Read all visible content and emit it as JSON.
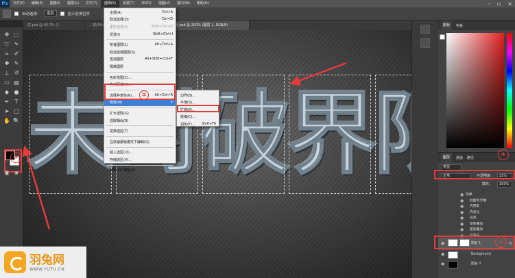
{
  "app": {
    "logo": "Ps"
  },
  "menubar": {
    "items": [
      "文件(F)",
      "编辑(E)",
      "图像(I)",
      "图层(L)",
      "文字(Y)",
      "选择(S)",
      "滤镜(T)",
      "3D(D)",
      "视图(V)",
      "窗口(W)",
      "帮助(H)"
    ],
    "active_index": 5
  },
  "options": {
    "auto_select_label": "自动选择：",
    "auto_select_value": "图层",
    "transform_label": "显示变换控件"
  },
  "tabs": [
    {
      "label": "优.psd @ 66.7% (1",
      "active": false
    },
    {
      "label": "…按(Alt+ctrl+…全图…",
      "active": false
    },
    {
      "label": "图文神经.psd @ 200% (图层 1, RGB/8)",
      "active": true
    }
  ],
  "select_menu": {
    "items": [
      {
        "label": "全部(A)",
        "shortcut": "Ctrl+A",
        "disabled": false
      },
      {
        "label": "取消选择(D)",
        "shortcut": "Ctrl+D",
        "disabled": false
      },
      {
        "label": "重新选择(E)",
        "shortcut": "Shift+Ctrl+D",
        "disabled": true
      },
      {
        "label": "反选(I)",
        "shortcut": "Shift+Ctrl+I",
        "disabled": false
      },
      {
        "sep": true
      },
      {
        "label": "所有图层(L)",
        "shortcut": "Alt+Ctrl+A",
        "disabled": false
      },
      {
        "label": "取消选择图层(S)",
        "shortcut": "",
        "disabled": false
      },
      {
        "label": "查找图层",
        "shortcut": "Alt+Shift+Ctrl+F",
        "disabled": false
      },
      {
        "label": "隔离图层",
        "shortcut": "",
        "disabled": false
      },
      {
        "sep": true
      },
      {
        "label": "色彩范围(C)...",
        "shortcut": "",
        "disabled": false
      },
      {
        "label": "焦点区域(U)...",
        "shortcut": "",
        "disabled": false
      },
      {
        "sep": true
      },
      {
        "label": "选择并遮住(K)...",
        "shortcut": "Alt+Ctrl+R",
        "disabled": false
      },
      {
        "label": "修改(M)",
        "shortcut": "▸",
        "disabled": false,
        "highlight": true
      },
      {
        "sep": true
      },
      {
        "label": "扩大选取(G)",
        "shortcut": "",
        "disabled": false
      },
      {
        "label": "选取相似(R)",
        "shortcut": "",
        "disabled": false
      },
      {
        "sep": true
      },
      {
        "label": "变换选区(T)",
        "shortcut": "",
        "disabled": false
      },
      {
        "sep": true
      },
      {
        "label": "在快速蒙版模式下编辑(Q)",
        "shortcut": "",
        "disabled": false
      },
      {
        "sep": true
      },
      {
        "label": "载入选区(O)...",
        "shortcut": "",
        "disabled": false
      },
      {
        "label": "存储选区(V)...",
        "shortcut": "",
        "disabled": false
      },
      {
        "sep": true
      },
      {
        "label": "新建 3D 模型(3)",
        "shortcut": "",
        "disabled": false
      }
    ]
  },
  "modify_submenu": {
    "items": [
      {
        "label": "边界(B)...",
        "shortcut": ""
      },
      {
        "label": "平滑(S)...",
        "shortcut": ""
      },
      {
        "label": "扩展(E)...",
        "shortcut": ""
      },
      {
        "label": "收缩(C)...",
        "shortcut": ""
      },
      {
        "label": "羽化(F)...",
        "shortcut": "Shift+F6"
      }
    ]
  },
  "canvas": {
    "characters": [
      "未",
      "时",
      "破",
      "界",
      "限"
    ]
  },
  "annotations": {
    "m1": "①",
    "m2": "②",
    "m3": "③",
    "m4": "④"
  },
  "color_panel": {
    "tabs": [
      "颜色",
      "色板"
    ]
  },
  "layers_panel": {
    "tabs": [
      "图层",
      "通道",
      "路径"
    ],
    "kind": "类型",
    "blend_mode": "正常",
    "opacity_label": "不透明度：",
    "opacity_value": "22%",
    "fill_label": "填充：",
    "fill_value": "100%",
    "effects": [
      "效果",
      "斜面和浮雕",
      "内阴影",
      "内发光",
      "光泽",
      "渐变叠加",
      "图案叠加",
      "外发光",
      "投影"
    ],
    "layers": [
      {
        "name": "图层 1",
        "fx": "fx",
        "selected": true
      },
      {
        "name": "Background",
        "fx": "",
        "selected": false
      },
      {
        "name": "图层 0",
        "fx": "",
        "selected": false
      }
    ]
  },
  "watermark": {
    "name": "羽兔网",
    "url": "WWW.YUTU.CN"
  },
  "colors": {
    "accent": "#e53b3b",
    "highlight": "#3c7fd4",
    "brand": "#f5a623"
  }
}
